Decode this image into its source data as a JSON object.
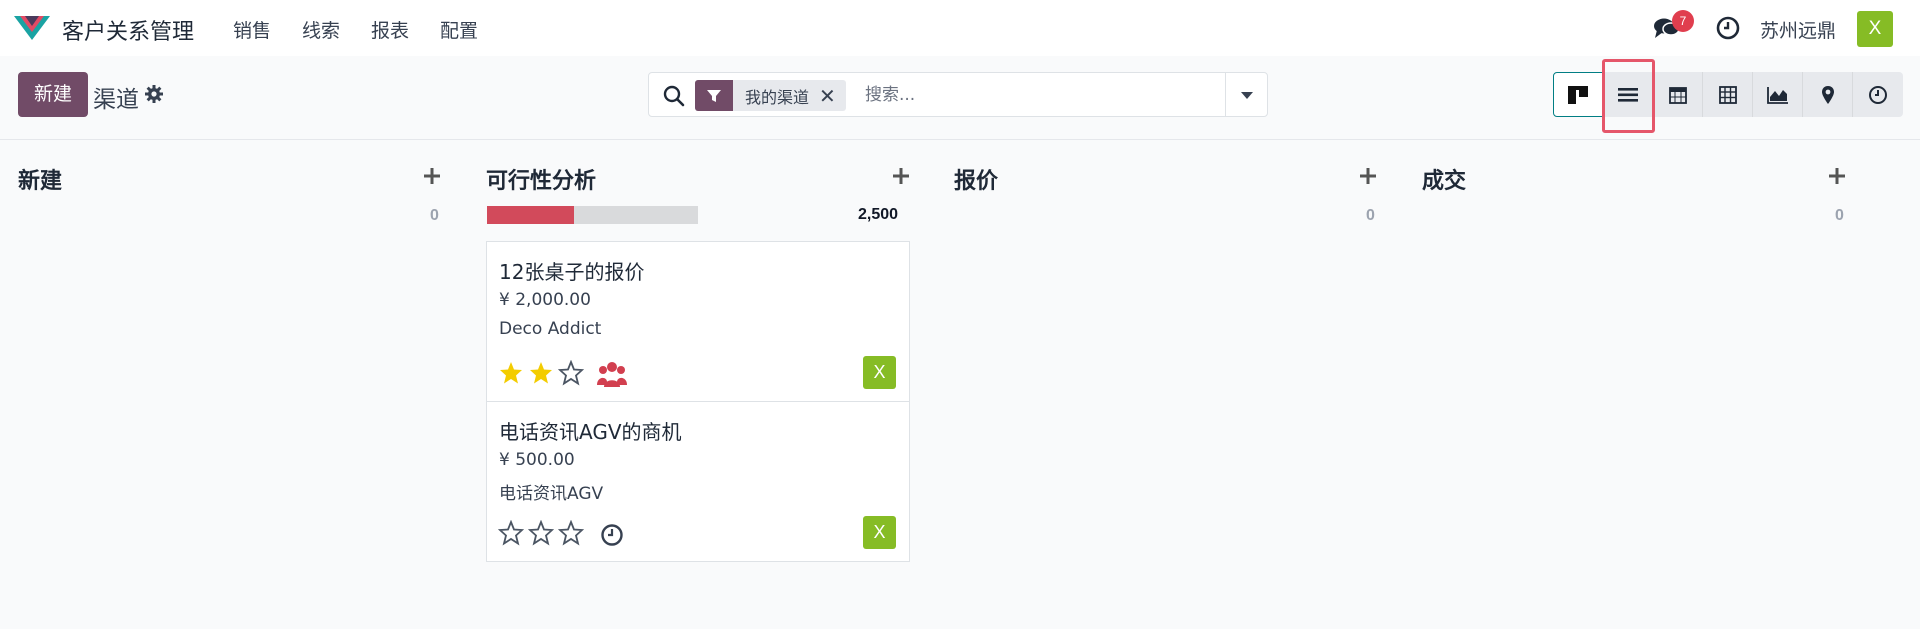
{
  "app": {
    "title": "客户关系管理"
  },
  "menu": [
    {
      "label": "销售"
    },
    {
      "label": "线索"
    },
    {
      "label": "报表"
    },
    {
      "label": "配置"
    }
  ],
  "topbar": {
    "notification_count": "7",
    "company": "苏州远鼎",
    "user_initial": "X"
  },
  "control": {
    "new_label": "新建",
    "breadcrumb": "渠道",
    "facet_label": "我的渠道",
    "facet_remove": "✕",
    "search_placeholder": "搜索..."
  },
  "views": [
    "kanban-icon",
    "list-icon",
    "calendar-icon",
    "pivot-icon",
    "graph-icon",
    "map-icon",
    "activity-icon"
  ],
  "columns": [
    {
      "title": "新建",
      "count": "0"
    },
    {
      "title": "可行性分析",
      "count": "2,500",
      "progress_red_fraction": 0.41
    },
    {
      "title": "报价",
      "count": "0"
    },
    {
      "title": "成交",
      "count": "0"
    }
  ],
  "cards": [
    {
      "title": "12张桌子的报价",
      "amount": "¥ 2,000.00",
      "partner": "Deco Addict",
      "stars": 2,
      "extra_icon": "users-icon",
      "avatar": "X"
    },
    {
      "title": "电话资讯AGV的商机",
      "amount": "¥ 500.00",
      "partner": "电话资讯AGV",
      "stars": 0,
      "extra_icon": "clock-icon",
      "avatar": "X"
    }
  ],
  "colors": {
    "brand": "#714b67",
    "avatar": "#86bc25",
    "star_filled": "#f3cc00",
    "progress_red": "#d24a5b",
    "highlight": "#e5566a"
  }
}
